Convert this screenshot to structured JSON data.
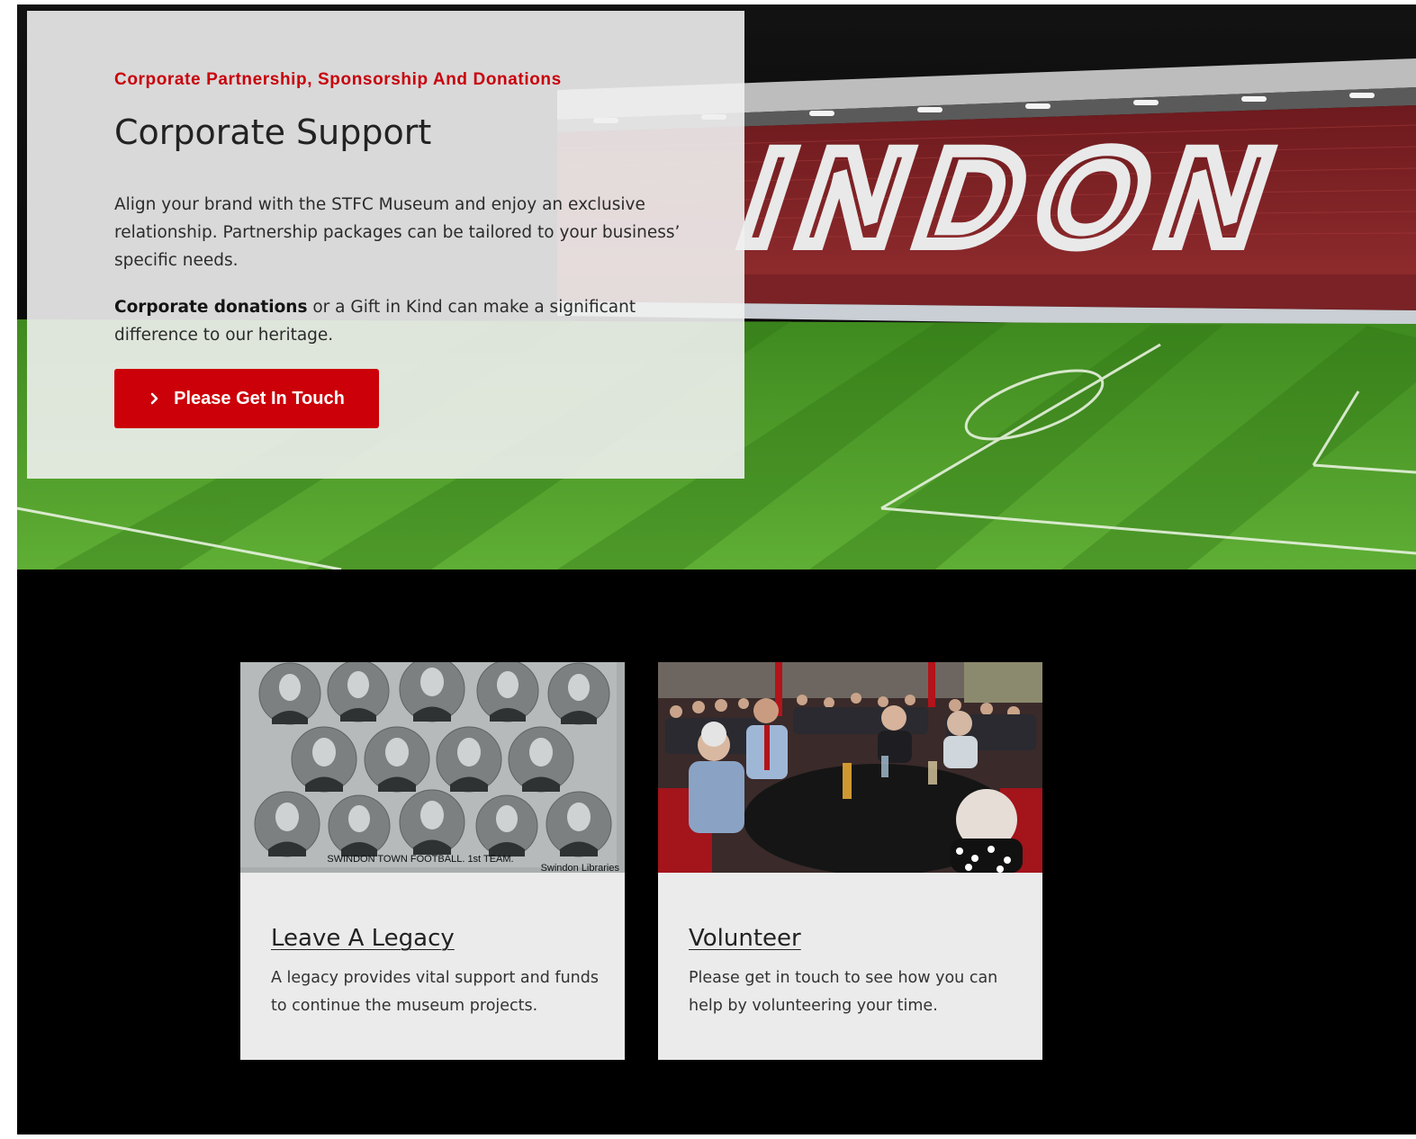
{
  "hero": {
    "eyebrow": "Corporate Partnership, Sponsorship And Donations",
    "title": "Corporate Support",
    "paragraph1": "Align your brand with the STFC Museum and enjoy an exclusive relationship. Partnership packages can be tailored to your business’ specific needs.",
    "paragraph2_bold": "Corporate donations",
    "paragraph2_rest": " or a Gift in Kind can make a significant difference to our heritage.",
    "cta_label": "Please Get In Touch",
    "cta_icon": "chevron-right-icon",
    "background_image": "stadium-pitch-photo",
    "stand_lettering": "INDON"
  },
  "cards": [
    {
      "title": "Leave A Legacy",
      "text": "A legacy provides vital support and funds to continue the museum projects.",
      "image": "team-portrait-photo",
      "image_team_caption": "SWINDON TOWN FOOTBALL. 1st TEAM.",
      "image_credit": "Swindon Libraries"
    },
    {
      "title": "Volunteer",
      "text": "Please get in touch to see how you can help by volunteering your time.",
      "image": "volunteer-event-photo"
    }
  ],
  "colors": {
    "accent_red": "#cc0008",
    "eyebrow_red": "#c8000b",
    "panel_bg": "#f0f0f0",
    "card_bg": "#ebebeb",
    "section_bg": "#000000",
    "pitch_green": "#4c9a2a"
  }
}
